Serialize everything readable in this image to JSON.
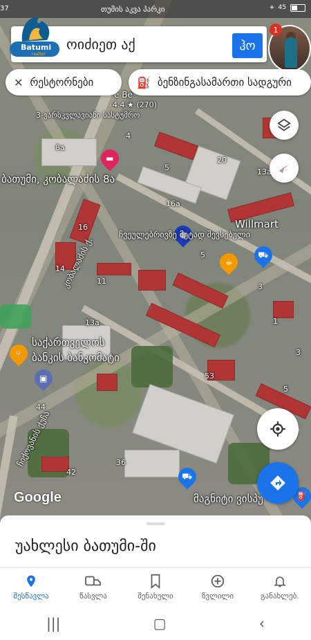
{
  "status_bar": {
    "time": "37",
    "notification_text": "თუმის აკვა პარკი",
    "battery": "45"
  },
  "search": {
    "placeholder": "ოიძიეთ აქ",
    "go_label": "ჰო",
    "logo_text": "Batumi",
    "logo_sub": "realtor"
  },
  "profile": {
    "badge_count": "1"
  },
  "chips": [
    {
      "label": "რესტორნები",
      "icon": "fork-knife-icon"
    },
    {
      "label": "ბენზინგასამართი სადგური",
      "icon": "fuel-pump-icon"
    }
  ],
  "map": {
    "labels": [
      {
        "text": "4.4 ★ (270)"
      },
      {
        "text": "3-ვარსკვლავიანი სასტუმრო"
      },
      {
        "text": "ბათუმი, კობალაძის 8ა"
      },
      {
        "text": "Willmart"
      },
      {
        "text": "ჩვეულებრივზე მეტად შევსებული"
      },
      {
        "text": "კობალაძის ქ."
      },
      {
        "text": "საქართველოს"
      },
      {
        "text": "ბანკის ბანკომატი"
      },
      {
        "text": "მაგნიტი ვისპუ"
      },
      {
        "text": "ჩიქოვანის ქუჩა"
      },
      {
        "text": "e Be"
      }
    ],
    "numbers": [
      "4",
      "8a",
      "5",
      "20",
      "13a",
      "16a",
      "16",
      "5",
      "14",
      "11",
      "3",
      "1",
      "13a",
      "3",
      "53",
      "5",
      "44",
      "36",
      "42"
    ],
    "attribution": "Google"
  },
  "sheet": {
    "title": "უახლესი ბათუმი-ში"
  },
  "bottom_nav": [
    {
      "label": "შესწავლა",
      "icon": "explore-pin-icon",
      "active": true
    },
    {
      "label": "წასვლა",
      "icon": "commute-icon",
      "active": false
    },
    {
      "label": "შენახული",
      "icon": "bookmark-icon",
      "active": false
    },
    {
      "label": "წვლილი",
      "icon": "add-circle-icon",
      "active": false
    },
    {
      "label": "განახლებ.",
      "icon": "bell-icon",
      "active": false
    }
  ],
  "colors": {
    "accent": "#1a73e8",
    "pin_red": "#e0245e",
    "pin_orange": "#f29900",
    "pin_blue": "#1a73e8"
  }
}
